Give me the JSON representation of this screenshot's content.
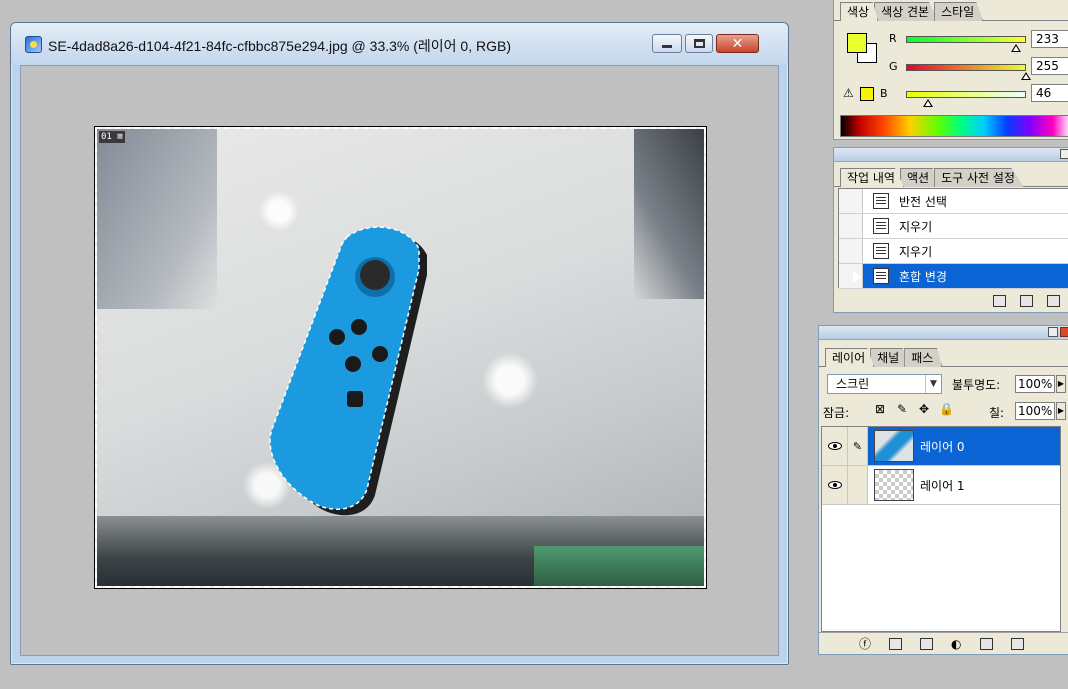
{
  "document_window": {
    "title": "SE-4dad8a26-d104-4f21-84fc-cfbbc875e294.jpg @ 33.3% (레이어 0, RGB)",
    "minimize": "–",
    "maximize": "□",
    "close": "✕",
    "layer_badge": "01 ⊠"
  },
  "color_panel": {
    "tabs": [
      "색상",
      "색상 견본",
      "스타일"
    ],
    "active_tab": 0,
    "foreground_color": "#e9ff2e",
    "background_color": "#ffffff",
    "sliders": [
      {
        "label": "R",
        "value": "233",
        "fraction": 0.914
      },
      {
        "label": "G",
        "value": "255",
        "fraction": 1.0
      },
      {
        "label": "B",
        "value": "46",
        "fraction": 0.18
      }
    ],
    "gamut_warning": "⚠"
  },
  "history_panel": {
    "tabs": [
      "작업 내역",
      "액션",
      "도구 사전 설정"
    ],
    "active_tab": 0,
    "items": [
      {
        "label": "반전 선택",
        "selected": false
      },
      {
        "label": "지우기",
        "selected": false
      },
      {
        "label": "지우기",
        "selected": false
      },
      {
        "label": "혼합 변경",
        "selected": true
      }
    ]
  },
  "layers_panel": {
    "tabs": [
      "레이어",
      "채널",
      "패스"
    ],
    "active_tab": 0,
    "blend_mode": "스크린",
    "opacity_label": "불투명도:",
    "opacity_value": "100%",
    "lock_label": "잠금:",
    "fill_label": "칠:",
    "fill_value": "100%",
    "layers": [
      {
        "name": "레이어 0",
        "selected": true,
        "visible": true
      },
      {
        "name": "레이어 1",
        "selected": false,
        "visible": true
      }
    ]
  }
}
